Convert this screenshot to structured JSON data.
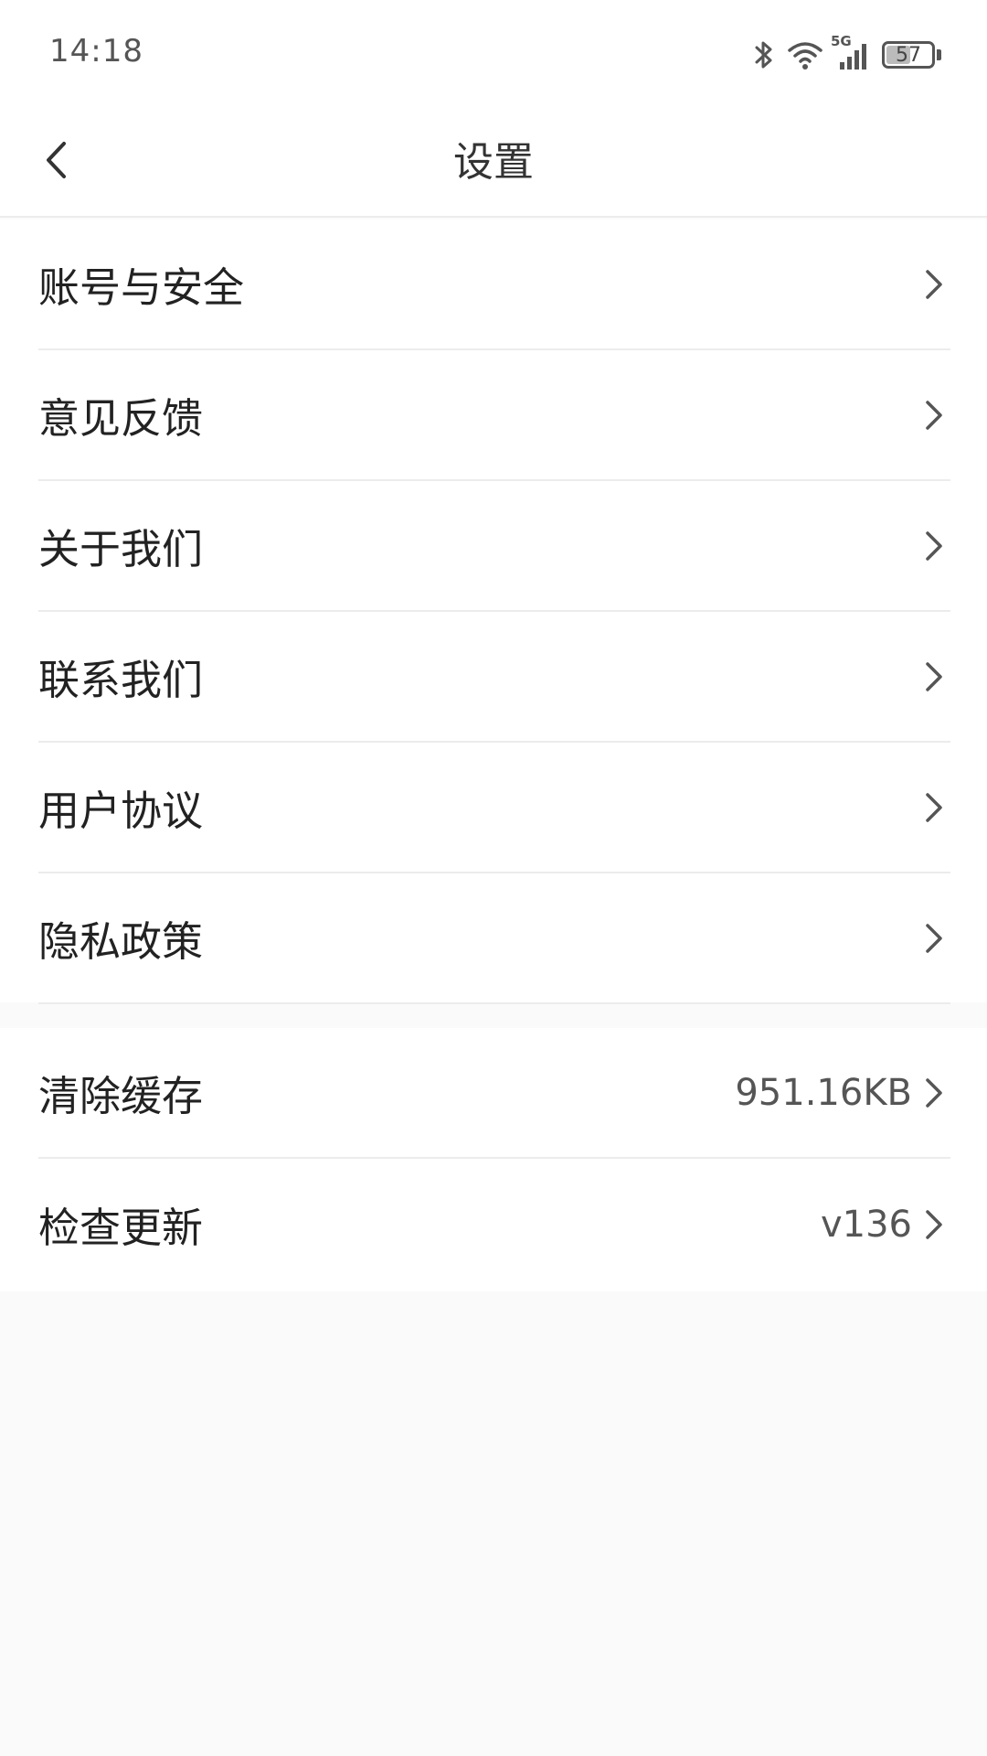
{
  "status_bar": {
    "time": "14:18",
    "network": "5G",
    "battery": "57",
    "battery_level": 0.57,
    "icons": [
      "bluetooth-icon",
      "wifi-icon",
      "cellular-signal-icon",
      "battery-icon"
    ]
  },
  "header": {
    "title": "设置",
    "back_icon": "chevron-left-icon"
  },
  "groups": [
    {
      "items": [
        {
          "label": "账号与安全"
        },
        {
          "label": "意见反馈"
        },
        {
          "label": "关于我们"
        },
        {
          "label": "联系我们"
        },
        {
          "label": "用户协议"
        },
        {
          "label": "隐私政策"
        }
      ]
    },
    {
      "items": [
        {
          "label": "清除缓存",
          "value": "951.16KB"
        },
        {
          "label": "检查更新",
          "value": "v136"
        }
      ]
    }
  ],
  "colors": {
    "page_background": "#fafafa",
    "card_background": "#ffffff",
    "divider": "#ececec",
    "text_primary": "#222222",
    "text_secondary": "#555555"
  }
}
